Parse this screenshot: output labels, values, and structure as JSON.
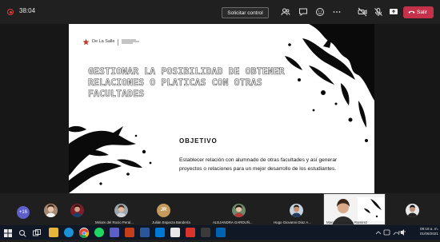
{
  "meeting": {
    "timer": "38:04",
    "request_control_label": "Solicitar control",
    "leave_label": "Salir"
  },
  "slide": {
    "logo_text": "De La Salle",
    "title": "GESTIONAR LA POSIBILIDAD DE OBTENER RELACIONES O PLATICAS CON OTRAS FACULTADES",
    "objective_label": "OBJETIVO",
    "objective_text": "Establecer relación con alumnado de otras facultades y así generar proyectos o relaciones para un mejor desarrollo de los estudiantes."
  },
  "presenter": {
    "name": "Maria Guadalupe Ramirez Hernandez"
  },
  "participants": {
    "overflow_count": "+16",
    "items": [
      {
        "name": "",
        "initials": ""
      },
      {
        "name": "",
        "initials": ""
      },
      {
        "name": "Miriam del Rocio Peral...",
        "initials": ""
      },
      {
        "name": "Julián Esparza Bandería",
        "initials": "JR"
      },
      {
        "name": "ALEJANDRA GARDUÑ...",
        "initials": ""
      },
      {
        "name": "Hugo Giovanni Díaz A...",
        "initials": ""
      },
      {
        "name": "Maria Guadalupe Ramirez",
        "initials": ""
      },
      {
        "name": "",
        "initials": ""
      }
    ]
  },
  "taskbar": {
    "language": "ESP",
    "time": "09:18 a. m.",
    "date": "01/06/2021"
  },
  "colors": {
    "leave": "#c4314b",
    "overflow_badge": "#5b5fc7",
    "taskbar": "#101826"
  }
}
